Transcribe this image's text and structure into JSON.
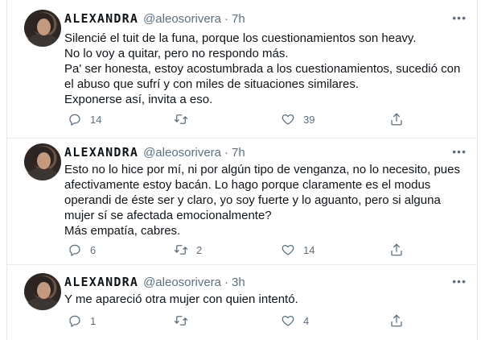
{
  "tweets": [
    {
      "name": "ALEXANDRA",
      "handle": "@aleosorivera",
      "separator": "·",
      "time": "7h",
      "lines": [
        "Silencié el tuit de la funa, porque los cuestionamientos son heavy.",
        "No lo voy a quitar, pero no respondo más.",
        "Pa' ser honesta, estoy acostumbrada a los cuestionamientos, sucedió con",
        "el abuso que sufrí y con miles de situaciones similares.",
        "Exponerse así, invita a eso."
      ],
      "replies": "14",
      "retweets": "",
      "likes": "39"
    },
    {
      "name": "ALEXANDRA",
      "handle": "@aleosorivera",
      "separator": "·",
      "time": "7h",
      "lines": [
        "Esto no lo hice por mí, ni por algún tipo de venganza, no lo necesito, pues",
        "afectivamente estoy bacán. Lo hago porque claramente es el modus",
        "operandi de éste ser y claro, yo soy fuerte y lo aguanto, pero si alguna",
        "mujer sí se afectada emocionalmente?",
        "Más empatía, cabres."
      ],
      "replies": "6",
      "retweets": "2",
      "likes": "14"
    },
    {
      "name": "ALEXANDRA",
      "handle": "@aleosorivera",
      "separator": "·",
      "time": "3h",
      "lines": [
        "Y me apareció otra mujer  con quien intentó."
      ],
      "replies": "1",
      "retweets": "",
      "likes": "4"
    }
  ],
  "icons": {
    "reply": "reply-icon",
    "retweet": "retweet-icon",
    "like": "heart-icon",
    "share": "share-icon",
    "more": "more-icon"
  },
  "colors": {
    "text": "#0f1419",
    "secondary": "#5b7083",
    "border": "#e6ecf0"
  }
}
